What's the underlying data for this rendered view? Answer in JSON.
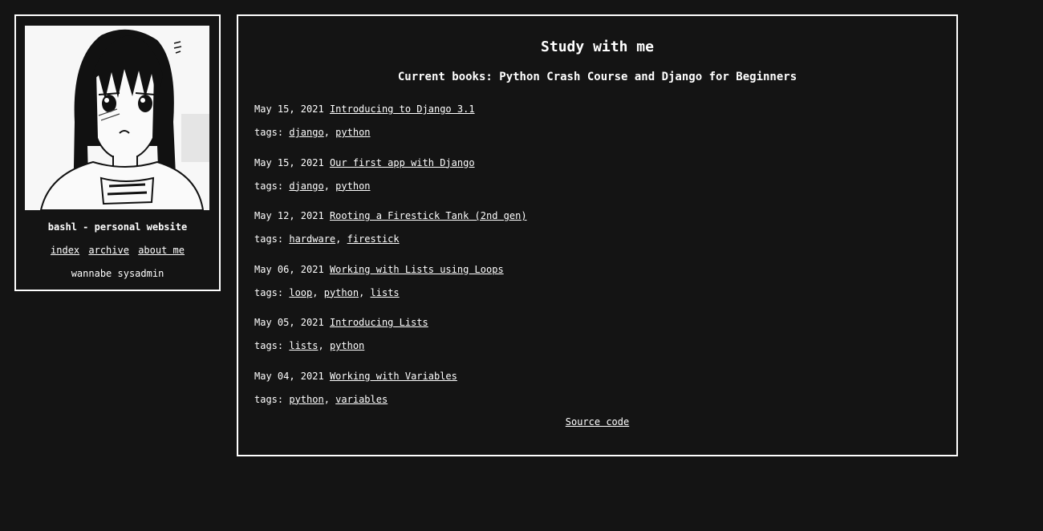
{
  "sidebar": {
    "site_name": "bashl - personal website",
    "nav": [
      {
        "label": "index"
      },
      {
        "label": "archive"
      },
      {
        "label": "about me"
      }
    ],
    "tagline": "wannabe sysadmin"
  },
  "main": {
    "title": "Study with me",
    "subtitle": "Current books: Python Crash Course and Django for Beginners",
    "tags_label": "tags:",
    "posts": [
      {
        "date": "May 15, 2021",
        "title": "Introducing to Django 3.1",
        "tags": [
          "django",
          "python"
        ]
      },
      {
        "date": "May 15, 2021",
        "title": "Our first app with Django",
        "tags": [
          "django",
          "python"
        ]
      },
      {
        "date": "May 12, 2021",
        "title": "Rooting a Firestick Tank (2nd gen)",
        "tags": [
          "hardware",
          "firestick"
        ]
      },
      {
        "date": "May 06, 2021",
        "title": "Working with Lists using Loops",
        "tags": [
          "loop",
          "python",
          "lists"
        ]
      },
      {
        "date": "May 05, 2021",
        "title": "Introducing Lists",
        "tags": [
          "lists",
          "python"
        ]
      },
      {
        "date": "May 04, 2021",
        "title": "Working with Variables",
        "tags": [
          "python",
          "variables"
        ]
      }
    ],
    "source_link": "Source code"
  },
  "colors": {
    "background": "#141414",
    "foreground": "#ffffff"
  }
}
